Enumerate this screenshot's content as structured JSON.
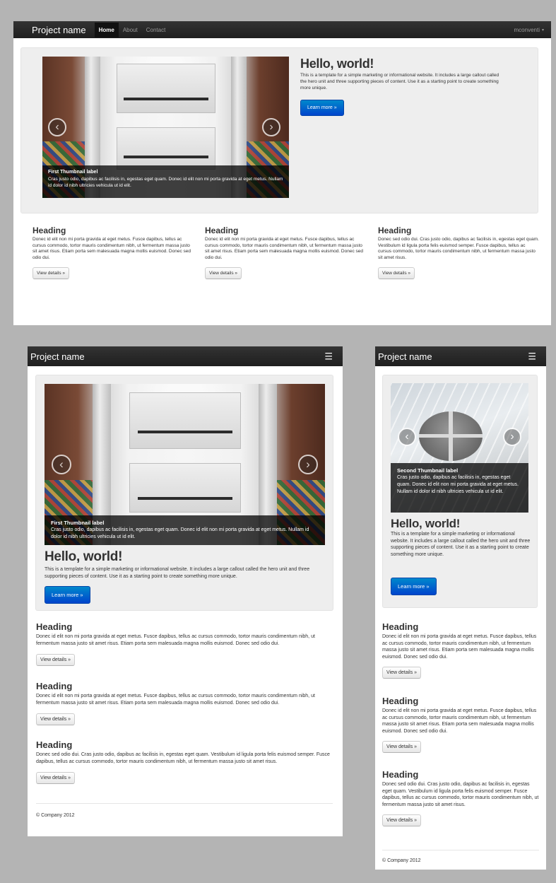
{
  "brand": "Project name",
  "nav": {
    "home": "Home",
    "about": "About",
    "contact": "Contact"
  },
  "user": {
    "name": "mconventi",
    "caret": "▾"
  },
  "menu_icon": "☰",
  "carousel": {
    "prev": "‹",
    "next": "›",
    "slide1": {
      "title": "First Thumbnail label",
      "text": "Cras justo odio, dapibus ac facilisis in, egestas eget quam. Donec id elit non mi porta gravida at eget metus. Nullam id dolor id nibh ultricies vehicula ut id elit."
    },
    "slide2": {
      "title": "Second Thumbnail label",
      "text": "Cras justo odio, dapibus ac facilisis in, egestas eget quam. Donec id elit non mi porta gravida at eget metus. Nullam id dolor id nibh ultricies vehicula ut id elit."
    }
  },
  "hero": {
    "title": "Hello, world!",
    "text": "This is a template for a simple marketing or informational website. It includes a large callout called the hero unit and three supporting pieces of content. Use it as a starting point to create something more unique.",
    "button": "Learn more »"
  },
  "columns": [
    {
      "heading": "Heading",
      "text": "Donec id elit non mi porta gravida at eget metus. Fusce dapibus, tellus ac cursus commodo, tortor mauris condimentum nibh, ut fermentum massa justo sit amet risus. Etiam porta sem malesuada magna mollis euismod. Donec sed odio dui.",
      "button": "View details »"
    },
    {
      "heading": "Heading",
      "text": "Donec id elit non mi porta gravida at eget metus. Fusce dapibus, tellus ac cursus commodo, tortor mauris condimentum nibh, ut fermentum massa justo sit amet risus. Etiam porta sem malesuada magna mollis euismod. Donec sed odio dui.",
      "button": "View details »"
    },
    {
      "heading": "Heading",
      "text": "Donec sed odio dui. Cras justo odio, dapibus ac facilisis in, egestas eget quam. Vestibulum id ligula porta felis euismod semper. Fusce dapibus, tellus ac cursus commodo, tortor mauris condimentum nibh, ut fermentum massa justo sit amet risus.",
      "button": "View details »"
    }
  ],
  "footer": "© Company 2012",
  "colors": {
    "navbar": "#222222",
    "primary": "#0055cc",
    "hero_bg": "#eeeeee",
    "page_bg": "#b4b4b4"
  },
  "icons": {
    "menu": "hamburger-menu-icon",
    "prev": "chevron-left-icon",
    "next": "chevron-right-icon",
    "caret": "caret-down-icon"
  }
}
